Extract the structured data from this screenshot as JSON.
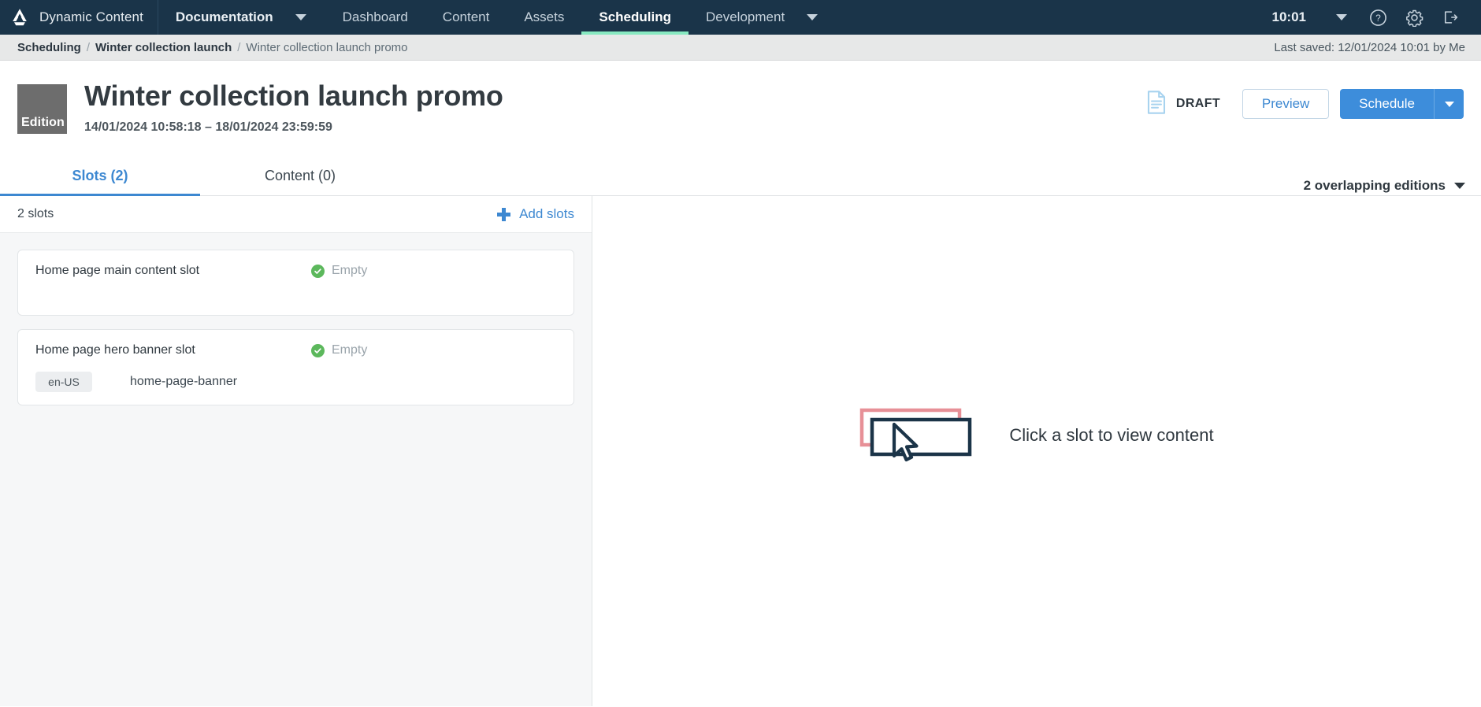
{
  "topnav": {
    "logo_icon": "dynamic-content-logo",
    "brand": "Dynamic Content",
    "items": [
      {
        "label": "Documentation",
        "active": false,
        "bold": true,
        "caret": true
      },
      {
        "label": "Dashboard",
        "active": false,
        "bold": false,
        "caret": false
      },
      {
        "label": "Content",
        "active": false,
        "bold": false,
        "caret": false
      },
      {
        "label": "Assets",
        "active": false,
        "bold": false,
        "caret": false
      },
      {
        "label": "Scheduling",
        "active": true,
        "bold": true,
        "caret": false
      },
      {
        "label": "Development",
        "active": false,
        "bold": false,
        "caret": true
      }
    ],
    "clock": "10:01",
    "icons": [
      "chevron-down-icon",
      "help-icon",
      "gear-icon",
      "logout-icon"
    ],
    "accent_underline": "#87e8c0",
    "background": "#1a3449"
  },
  "breadcrumb": {
    "level1": "Scheduling",
    "level2": "Winter collection launch",
    "level3": "Winter collection launch promo",
    "separator": "/",
    "last_saved": "Last saved: 12/01/2024 10:01 by Me"
  },
  "header": {
    "badge_label": "Edition",
    "title": "Winter collection launch promo",
    "date_range": "14/01/2024 10:58:18 – 18/01/2024 23:59:59",
    "status_label": "DRAFT",
    "status_icon": "draft-document-icon",
    "preview_label": "Preview",
    "schedule_label": "Schedule",
    "schedule_caret_icon": "chevron-down-icon",
    "primary_color": "#3d8ddb"
  },
  "tabs": [
    {
      "label": "Slots (2)",
      "active": true
    },
    {
      "label": "Content (0)",
      "active": false
    }
  ],
  "overlapping": {
    "label": "2 overlapping editions",
    "caret_icon": "chevron-down-icon"
  },
  "slots_panel": {
    "count_label": "2 slots",
    "add_label": "Add slots",
    "add_icon": "plus-icon",
    "slots": [
      {
        "name": "Home page main content slot",
        "status": "Empty",
        "status_icon": "check-circle-icon",
        "locale": "",
        "content_key": ""
      },
      {
        "name": "Home page hero banner slot",
        "status": "Empty",
        "status_icon": "check-circle-icon",
        "locale": "en-US",
        "content_key": "home-page-banner"
      }
    ]
  },
  "empty_state": {
    "message": "Click a slot to view content",
    "illustration_icon": "click-slot-illustration",
    "illustration_colors": {
      "front": "#1b3448",
      "back": "#e79097"
    }
  }
}
